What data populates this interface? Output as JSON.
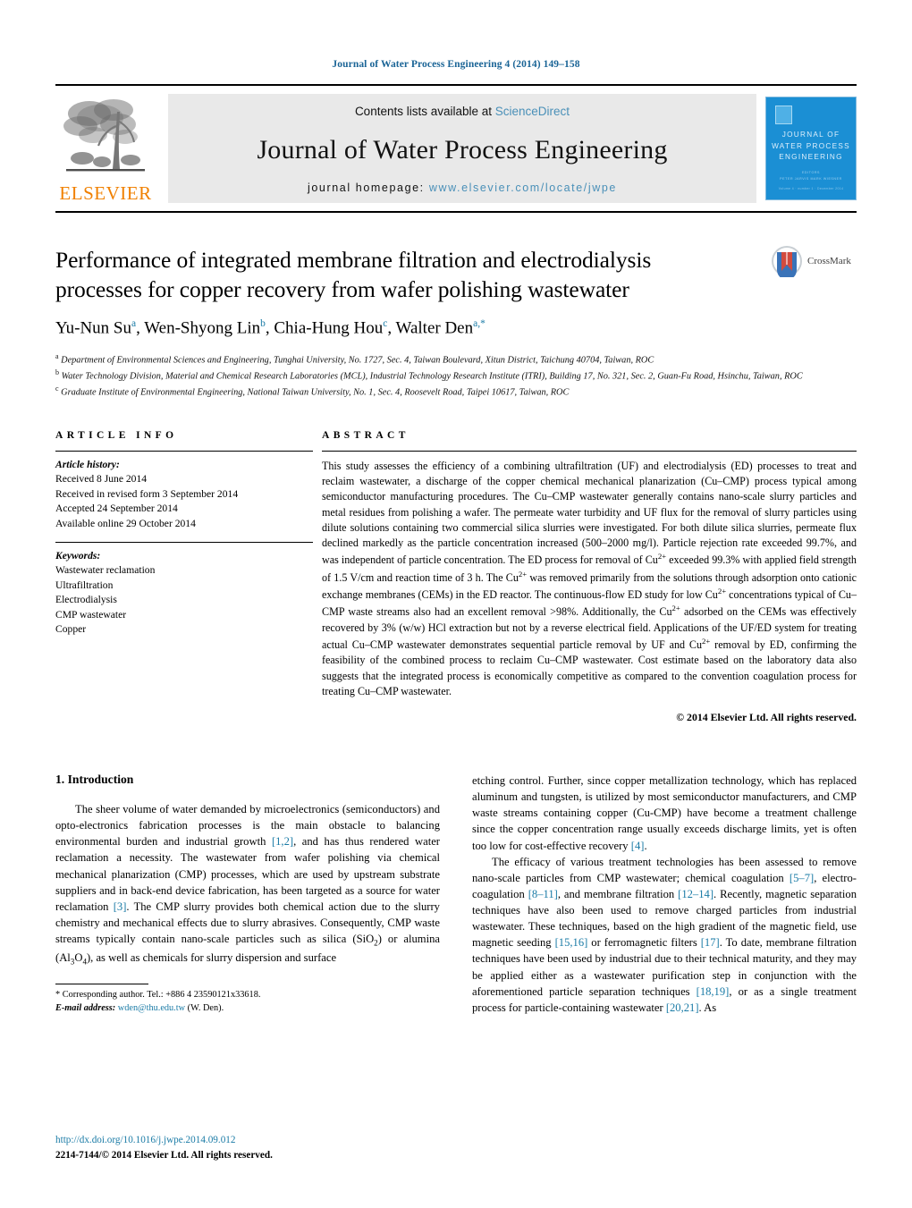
{
  "running_head": "Journal of Water Process Engineering 4 (2014) 149–158",
  "masthead": {
    "contents_prefix": "Contents lists available at ",
    "sciencedirect": "ScienceDirect",
    "journal_name": "Journal of Water Process Engineering",
    "homepage_prefix": "journal homepage: ",
    "homepage_url": "www.elsevier.com/locate/jwpe",
    "publisher_wordmark": "ELSEVIER",
    "cover": {
      "title_line1": "JOURNAL OF",
      "title_line2": "WATER PROCESS",
      "title_line3": "ENGINEERING",
      "editors_label": "EDITORS",
      "editors": "PETER JARVIS    MARK WIESNER",
      "footer": "Volume 4 · number 1 · December 2014"
    },
    "link_color": "#4a90b8",
    "brand_orange": "#f08000"
  },
  "article": {
    "title": "Performance of integrated membrane filtration and electrodialysis processes for copper recovery from wafer polishing wastewater",
    "authors_html": "Yu-Nun Su<sup>a</sup>, Wen-Shyong Lin<sup>b</sup>, Chia-Hung Hou<sup>c</sup>, Walter Den<sup>a,*</sup>",
    "crossmark_label": "CrossMark",
    "affiliations": [
      {
        "marker": "a",
        "text": "Department of Environmental Sciences and Engineering, Tunghai University, No. 1727, Sec. 4, Taiwan Boulevard, Xitun District, Taichung 40704, Taiwan, ROC"
      },
      {
        "marker": "b",
        "text": "Water Technology Division, Material and Chemical Research Laboratories (MCL), Industrial Technology Research Institute (ITRI), Building 17, No. 321, Sec. 2, Guan-Fu Road, Hsinchu, Taiwan, ROC"
      },
      {
        "marker": "c",
        "text": "Graduate Institute of Environmental Engineering, National Taiwan University, No. 1, Sec. 4, Roosevelt Road, Taipei 10617, Taiwan, ROC"
      }
    ]
  },
  "article_info": {
    "heading": "ARTICLE INFO",
    "history_label": "Article history:",
    "history": [
      "Received 8 June 2014",
      "Received in revised form 3 September 2014",
      "Accepted 24 September 2014",
      "Available online 29 October 2014"
    ],
    "keywords_label": "Keywords:",
    "keywords": [
      "Wastewater reclamation",
      "Ultrafiltration",
      "Electrodialysis",
      "CMP wastewater",
      "Copper"
    ]
  },
  "abstract": {
    "heading": "ABSTRACT",
    "text_html": "This study assesses the efficiency of a combining ultrafiltration (UF) and electrodialysis (ED) processes to treat and reclaim wastewater, a discharge of the copper chemical mechanical planarization (Cu&ndash;CMP) process typical among semiconductor manufacturing procedures. The Cu&ndash;CMP wastewater generally contains nano-scale slurry particles and metal residues from polishing a wafer. The permeate water turbidity and UF flux for the removal of slurry particles using dilute solutions containing two commercial silica slurries were investigated. For both dilute silica slurries, permeate flux declined markedly as the particle concentration increased (500&ndash;2000 mg/l). Particle rejection rate exceeded 99.7%, and was independent of particle concentration. The ED process for removal of Cu<sup class=\"num\">2+</sup> exceeded 99.3% with applied field strength of 1.5 V/cm and reaction time of 3 h. The Cu<sup class=\"num\">2+</sup> was removed primarily from the solutions through adsorption onto cationic exchange membranes (CEMs) in the ED reactor. The continuous-flow ED study for low Cu<sup class=\"num\">2+</sup> concentrations typical of Cu&ndash;CMP waste streams also had an excellent removal &gt;98%. Additionally, the Cu<sup class=\"num\">2+</sup> adsorbed on the CEMs was effectively recovered by 3% (w/w) HCl extraction but not by a reverse electrical field. Applications of the UF/ED system for treating actual Cu&ndash;CMP wastewater demonstrates sequential particle removal by UF and Cu<sup class=\"num\">2+</sup> removal by ED, confirming the feasibility of the combined process to reclaim Cu&ndash;CMP wastewater. Cost estimate based on the laboratory data also suggests that the integrated process is economically competitive as compared to the convention coagulation process for treating Cu&ndash;CMP wastewater.",
    "copyright": "© 2014 Elsevier Ltd. All rights reserved."
  },
  "introduction": {
    "heading": "1.  Introduction",
    "left_paragraph_html": "The sheer volume of water demanded by microelectronics (semiconductors) and opto-electronics fabrication processes is the main obstacle to balancing environmental burden and industrial growth <span class=\"ref\">[1,2]</span>, and has thus rendered water reclamation a necessity. The wastewater from wafer polishing via chemical mechanical planarization (CMP) processes, which are used by upstream substrate suppliers and in back-end device fabrication, has been targeted as a source for water reclamation <span class=\"ref\">[3]</span>. The CMP slurry provides both chemical action due to the slurry chemistry and mechanical effects due to slurry abrasives. Consequently, CMP waste streams typically contain nano-scale particles such as silica (SiO<sub>2</sub>) or alumina (Al<sub>3</sub>O<sub>4</sub>), as well as chemicals for slurry dispersion and surface",
    "right_paragraph_1_html": "etching control. Further, since copper metallization technology, which has replaced aluminum and tungsten, is utilized by most semiconductor manufacturers, and CMP waste streams containing copper (Cu-CMP) have become a treatment challenge since the copper concentration range usually exceeds discharge limits, yet is often too low for cost-effective recovery <span class=\"ref\">[4]</span>.",
    "right_paragraph_2_html": "The efficacy of various treatment technologies has been assessed to remove nano-scale particles from CMP wastewater; chemical coagulation <span class=\"ref\">[5&ndash;7]</span>, electro-coagulation <span class=\"ref\">[8&ndash;11]</span>, and membrane filtration <span class=\"ref\">[12&ndash;14]</span>. Recently, magnetic separation techniques have also been used to remove charged particles from industrial wastewater. These techniques, based on the high gradient of the magnetic field, use magnetic seeding <span class=\"ref\">[15,16]</span> or ferromagnetic filters <span class=\"ref\">[17]</span>. To date, membrane filtration techniques have been used by industrial due to their technical maturity, and they may be applied either as a wastewater purification step in conjunction with the aforementioned particle separation techniques <span class=\"ref\">[18,19]</span>, or as a single treatment process for particle-containing wastewater <span class=\"ref\">[20,21]</span>. As"
  },
  "footnote": {
    "corresponding_html": "* Corresponding author. Tel.: +886 4 23590121x33618.",
    "email_html": "<span class=\"ital\">E-mail address:</span> <span class=\"mail\">wden@thu.edu.tw</span> (W. Den)."
  },
  "footer": {
    "doi": "http://dx.doi.org/10.1016/j.jwpe.2014.09.012",
    "issn_line": "2214-7144/© 2014 Elsevier Ltd. All rights reserved."
  }
}
